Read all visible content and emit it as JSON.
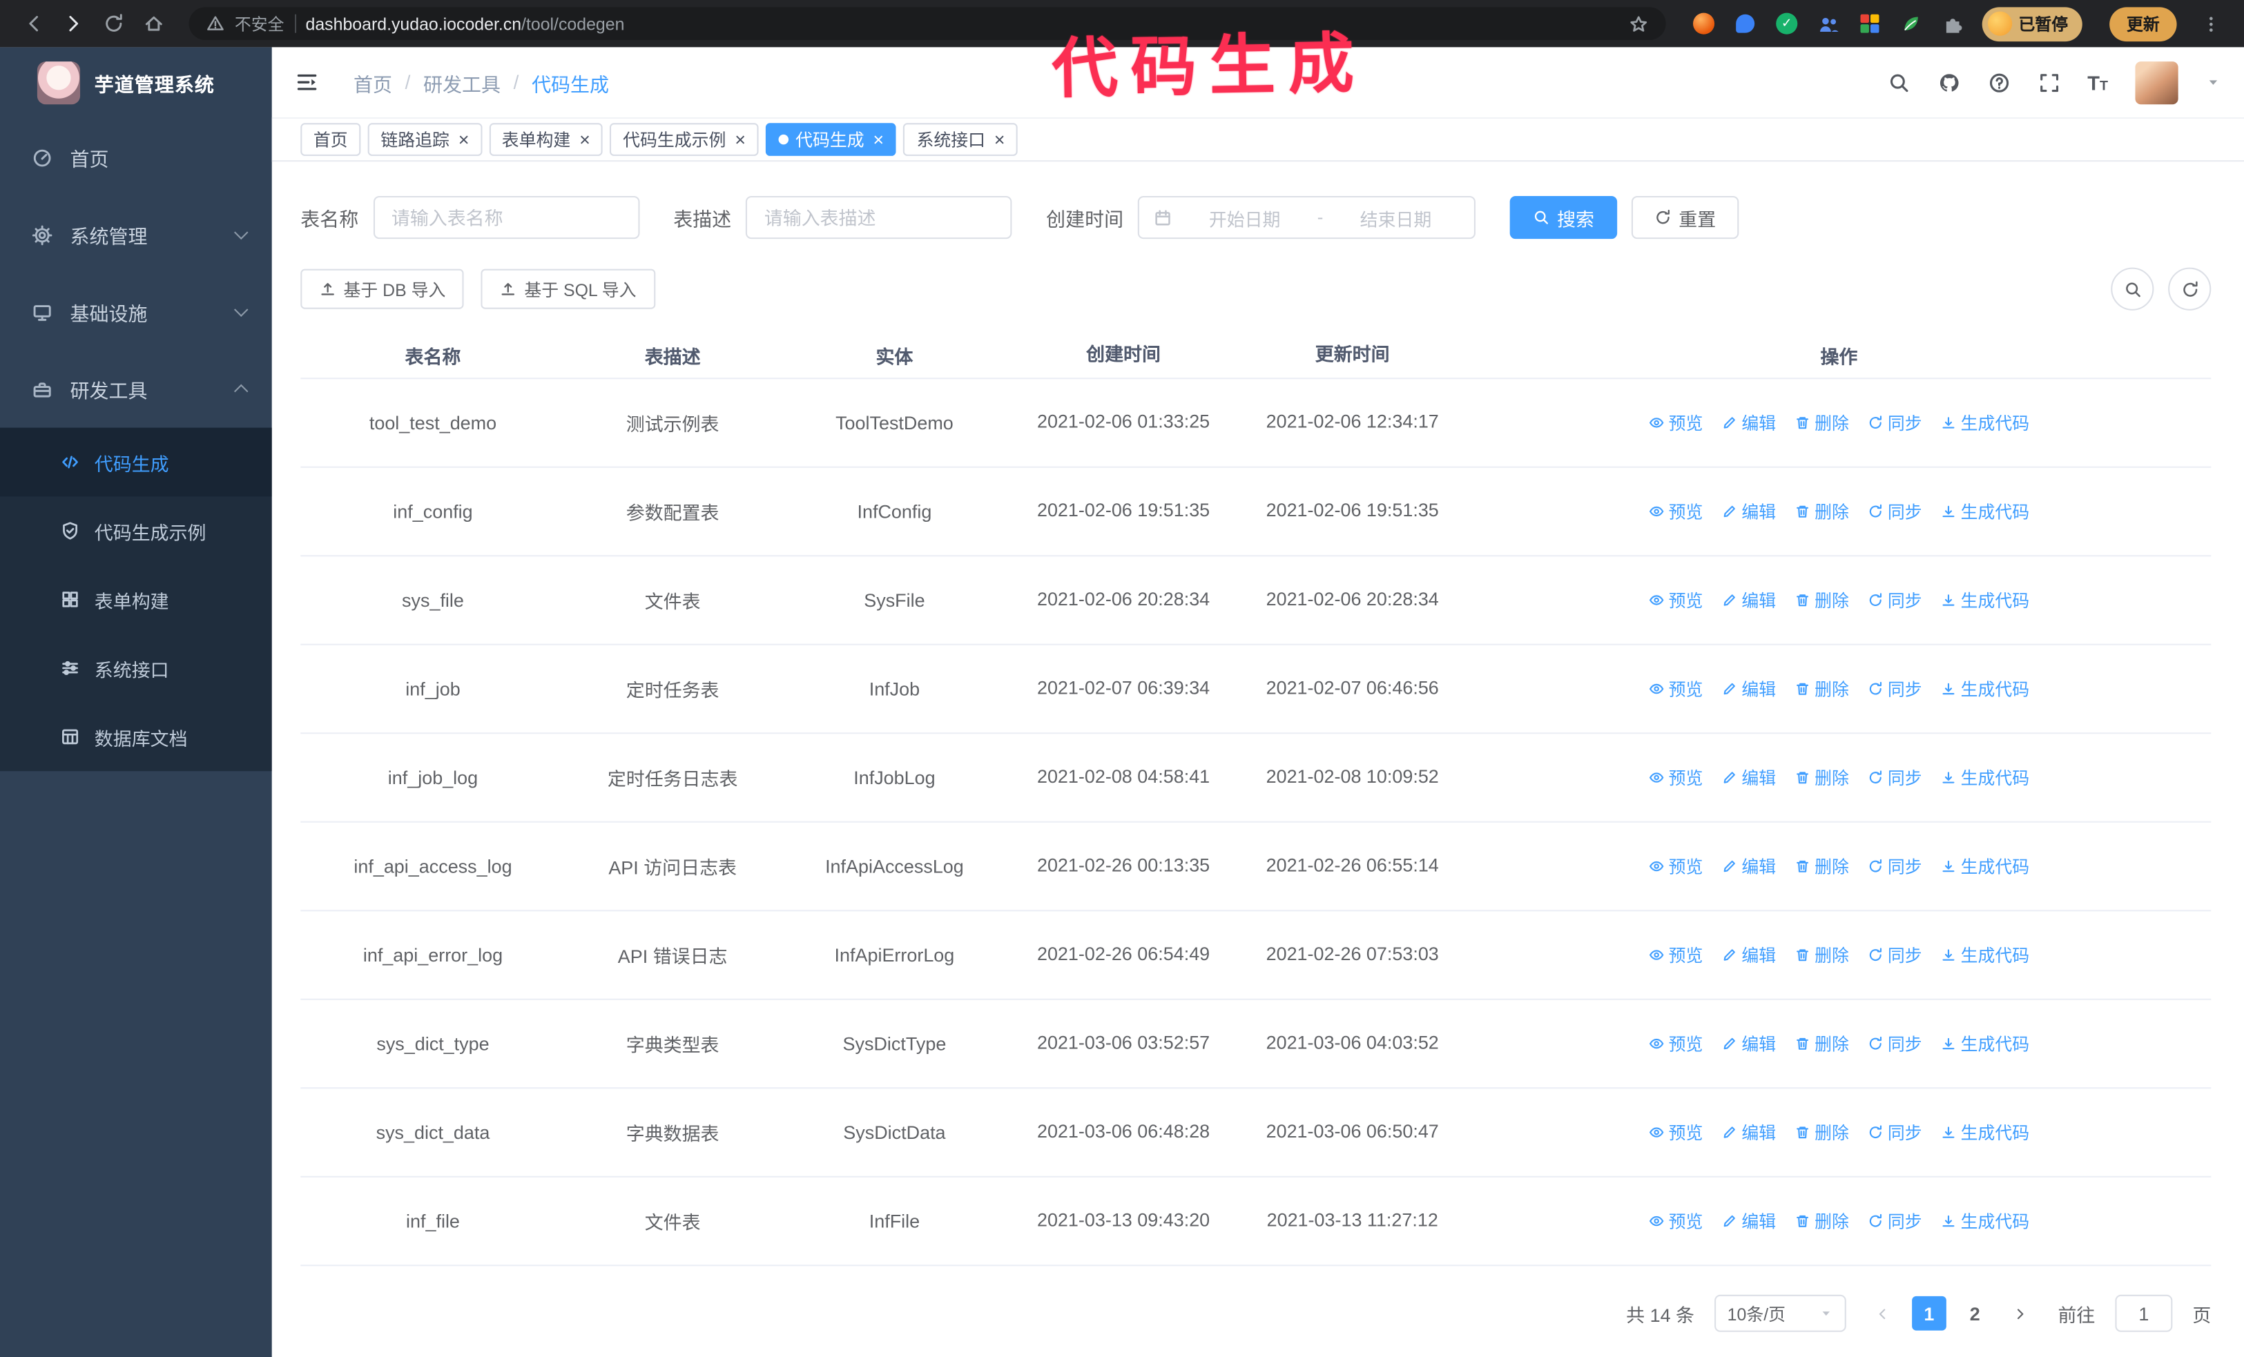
{
  "browser": {
    "security_label": "不安全",
    "url_domain": "dashboard.yudao.iocoder.cn",
    "url_path": "/tool/codegen",
    "paused_badge": "已暂停",
    "update_button": "更新"
  },
  "annotation": {
    "text": "代码生成",
    "color": "#fb2e52"
  },
  "sidebar": {
    "logo_title": "芋道管理系统",
    "items": [
      {
        "label": "首页",
        "icon": "dashboard"
      },
      {
        "label": "系统管理",
        "icon": "gear",
        "chevron": "down"
      },
      {
        "label": "基础设施",
        "icon": "monitor",
        "chevron": "down"
      },
      {
        "label": "研发工具",
        "icon": "toolbox",
        "chevron": "up",
        "expanded": true
      }
    ],
    "submenu": [
      {
        "label": "代码生成",
        "icon": "code",
        "active": true
      },
      {
        "label": "代码生成示例",
        "icon": "shield"
      },
      {
        "label": "表单构建",
        "icon": "grid"
      },
      {
        "label": "系统接口",
        "icon": "sliders"
      },
      {
        "label": "数据库文档",
        "icon": "db-table"
      }
    ]
  },
  "header": {
    "breadcrumb": [
      "首页",
      "研发工具",
      "代码生成"
    ]
  },
  "tabs": [
    {
      "label": "首页",
      "closable": false,
      "active": false
    },
    {
      "label": "链路追踪",
      "closable": true,
      "active": false
    },
    {
      "label": "表单构建",
      "closable": true,
      "active": false
    },
    {
      "label": "代码生成示例",
      "closable": true,
      "active": false
    },
    {
      "label": "代码生成",
      "closable": true,
      "active": true
    },
    {
      "label": "系统接口",
      "closable": true,
      "active": false
    }
  ],
  "filters": {
    "table_name_label": "表名称",
    "table_name_placeholder": "请输入表名称",
    "table_desc_label": "表描述",
    "table_desc_placeholder": "请输入表描述",
    "create_time_label": "创建时间",
    "date_start_placeholder": "开始日期",
    "date_separator": "-",
    "date_end_placeholder": "结束日期",
    "search_button": "搜索",
    "reset_button": "重置"
  },
  "toolbar": {
    "import_db_button": "基于 DB 导入",
    "import_sql_button": "基于 SQL 导入"
  },
  "table": {
    "columns": [
      "表名称",
      "表描述",
      "实体",
      "创建时间",
      "更新时间",
      "操作"
    ],
    "actions": [
      "预览",
      "编辑",
      "删除",
      "同步",
      "生成代码"
    ],
    "rows": [
      {
        "name": "tool_test_demo",
        "desc": "测试示例表",
        "entity": "ToolTestDemo",
        "created": "2021-02-06 01:33:25",
        "updated": "2021-02-06 12:34:17"
      },
      {
        "name": "inf_config",
        "desc": "参数配置表",
        "entity": "InfConfig",
        "created": "2021-02-06 19:51:35",
        "updated": "2021-02-06 19:51:35"
      },
      {
        "name": "sys_file",
        "desc": "文件表",
        "entity": "SysFile",
        "created": "2021-02-06 20:28:34",
        "updated": "2021-02-06 20:28:34"
      },
      {
        "name": "inf_job",
        "desc": "定时任务表",
        "entity": "InfJob",
        "created": "2021-02-07 06:39:34",
        "updated": "2021-02-07 06:46:56"
      },
      {
        "name": "inf_job_log",
        "desc": "定时任务日志表",
        "entity": "InfJobLog",
        "created": "2021-02-08 04:58:41",
        "updated": "2021-02-08 10:09:52"
      },
      {
        "name": "inf_api_access_log",
        "desc": "API 访问日志表",
        "entity": "InfApiAccessLog",
        "created": "2021-02-26 00:13:35",
        "updated": "2021-02-26 06:55:14"
      },
      {
        "name": "inf_api_error_log",
        "desc": "API 错误日志",
        "entity": "InfApiErrorLog",
        "created": "2021-02-26 06:54:49",
        "updated": "2021-02-26 07:53:03"
      },
      {
        "name": "sys_dict_type",
        "desc": "字典类型表",
        "entity": "SysDictType",
        "created": "2021-03-06 03:52:57",
        "updated": "2021-03-06 04:03:52"
      },
      {
        "name": "sys_dict_data",
        "desc": "字典数据表",
        "entity": "SysDictData",
        "created": "2021-03-06 06:48:28",
        "updated": "2021-03-06 06:50:47"
      },
      {
        "name": "inf_file",
        "desc": "文件表",
        "entity": "InfFile",
        "created": "2021-03-13 09:43:20",
        "updated": "2021-03-13 11:27:12"
      }
    ]
  },
  "pagination": {
    "total": "共 14 条",
    "page_size": "10条/页",
    "pages": [
      "1",
      "2"
    ],
    "active_page": "1",
    "goto_label": "前往",
    "goto_value": "1",
    "page_suffix": "页"
  },
  "colors": {
    "accent": "#409EFF",
    "sidebar_bg": "#304156",
    "submenu_bg": "#1f2d3d"
  }
}
